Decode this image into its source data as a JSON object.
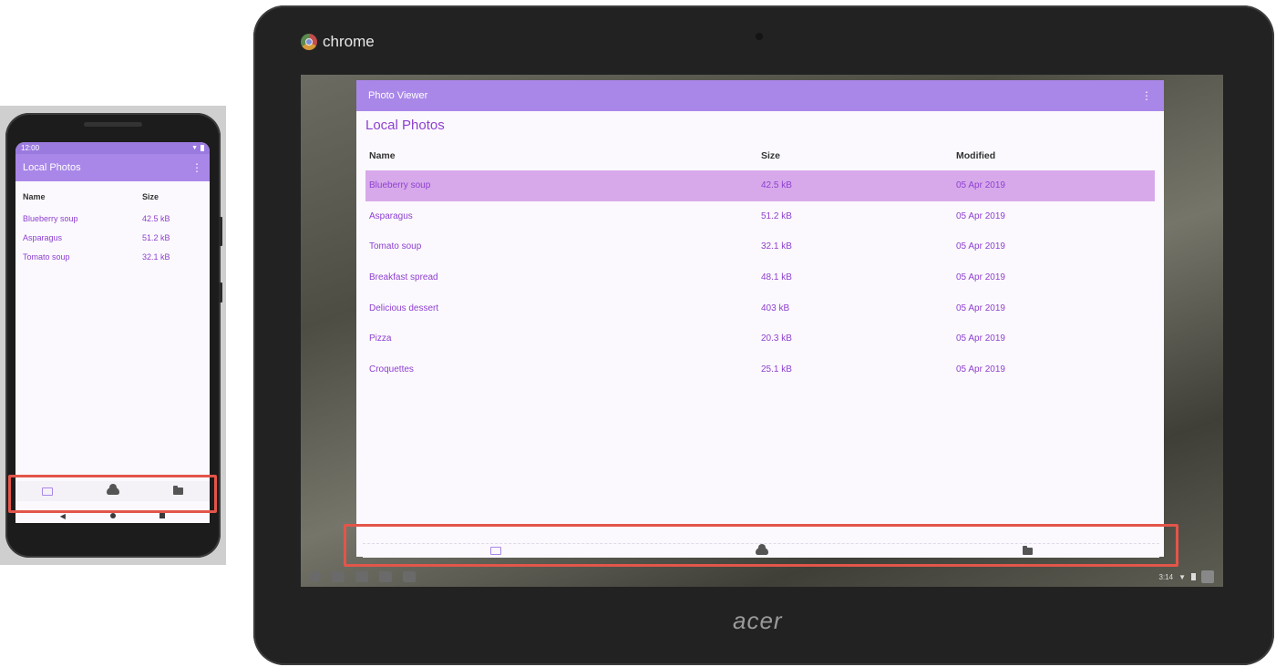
{
  "phone": {
    "status_time": "12:00",
    "app_title": "Local Photos",
    "more_icon": "⋮",
    "table": {
      "headers": [
        "Name",
        "Size"
      ],
      "rows": [
        {
          "name": "Blueberry soup",
          "size": "42.5 kB"
        },
        {
          "name": "Asparagus",
          "size": "51.2 kB"
        },
        {
          "name": "Tomato soup",
          "size": "32.1 kB"
        }
      ]
    },
    "nav": [
      "photo-icon",
      "cloud-icon",
      "folder-icon"
    ]
  },
  "tablet": {
    "brand_label": "chrome",
    "device_brand": "acer",
    "window": {
      "app_title": "Photo Viewer",
      "more_icon": "⋮",
      "page_title": "Local Photos",
      "table": {
        "headers": [
          "Name",
          "Size",
          "Modified"
        ],
        "rows": [
          {
            "name": "Blueberry soup",
            "size": "42.5 kB",
            "modified": "05 Apr 2019",
            "selected": true
          },
          {
            "name": "Asparagus",
            "size": "51.2 kB",
            "modified": "05 Apr 2019"
          },
          {
            "name": "Tomato soup",
            "size": "32.1 kB",
            "modified": "05 Apr 2019"
          },
          {
            "name": "Breakfast spread",
            "size": "48.1 kB",
            "modified": "05 Apr 2019"
          },
          {
            "name": "Delicious dessert",
            "size": "403 kB",
            "modified": "05 Apr 2019"
          },
          {
            "name": "Pizza",
            "size": "20.3 kB",
            "modified": "05 Apr 2019"
          },
          {
            "name": "Croquettes",
            "size": "25.1 kB",
            "modified": "05 Apr 2019"
          }
        ]
      },
      "nav": [
        "photo-icon",
        "cloud-icon",
        "folder-icon"
      ]
    },
    "shelf_time": "3:14"
  },
  "colors": {
    "accent": "#a987e8",
    "row_text": "#8e3fd1",
    "selected_row": "#d7a9ea",
    "highlight_box": "#e3554a"
  }
}
